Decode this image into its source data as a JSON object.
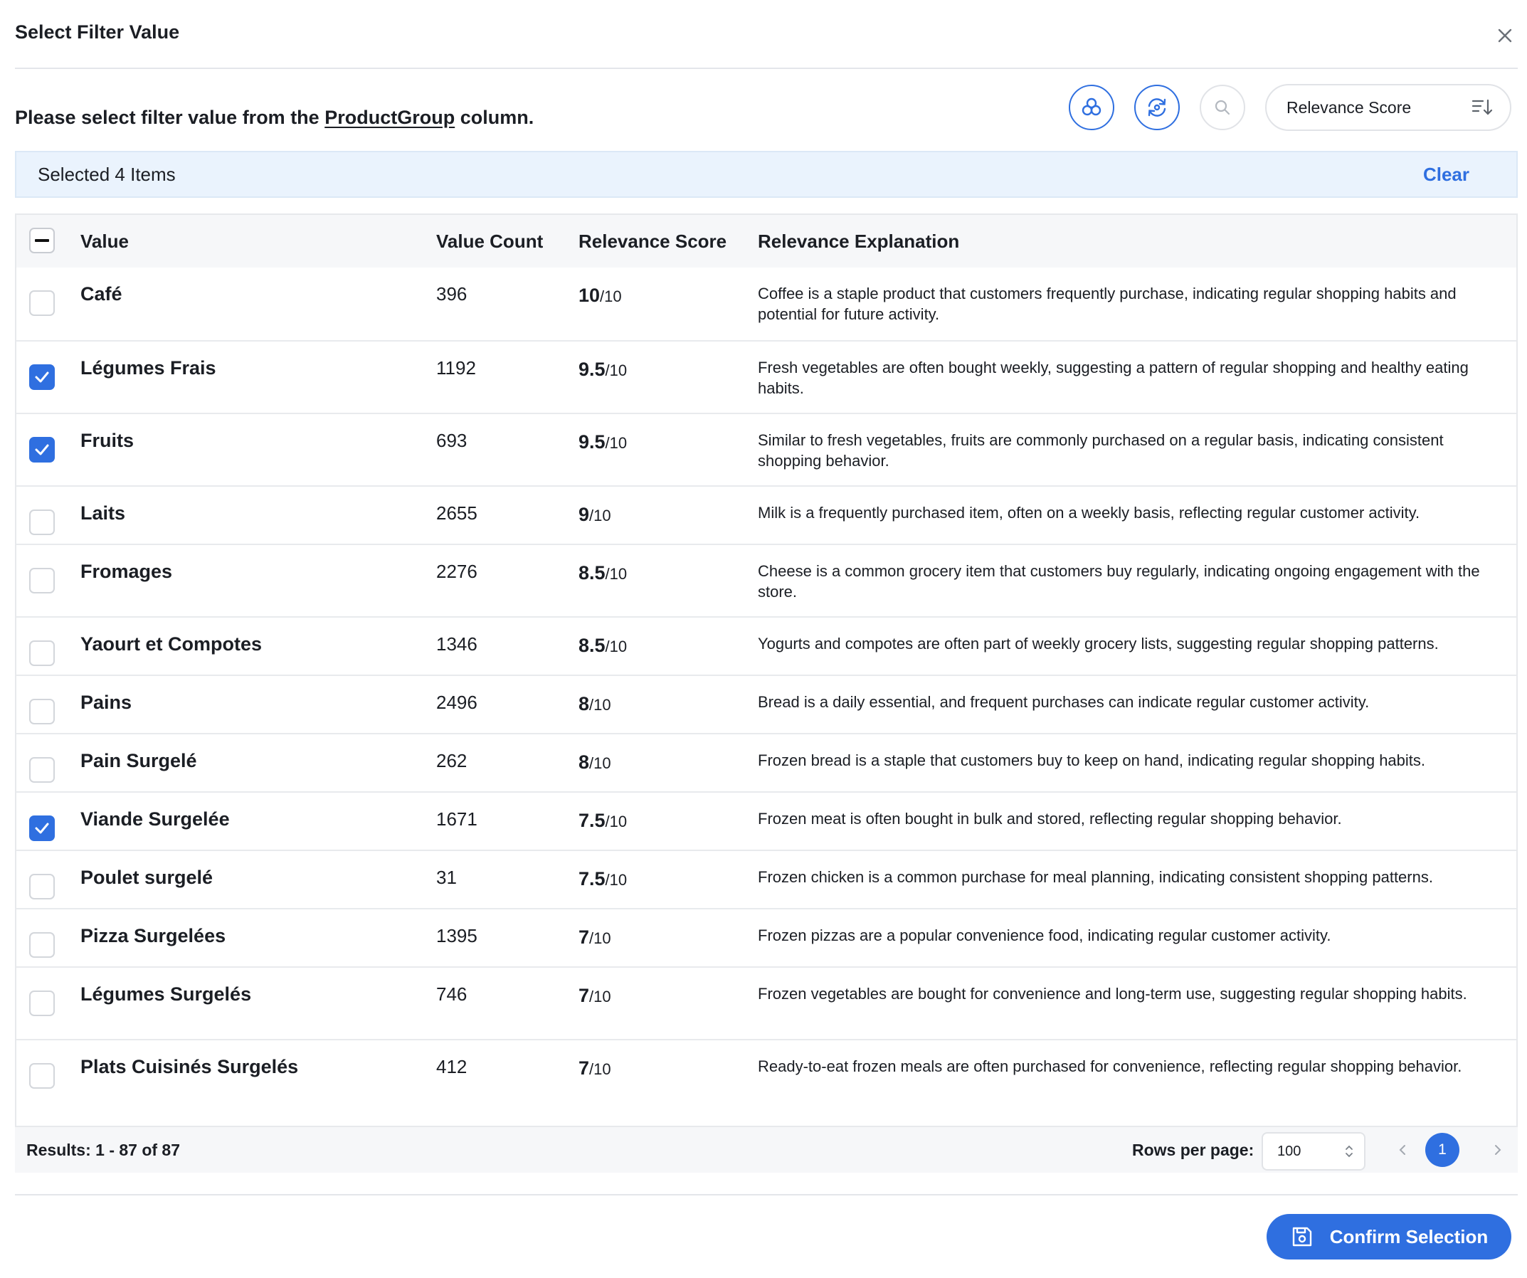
{
  "dialog": {
    "title": "Select Filter Value"
  },
  "prompt": {
    "before": "Please select filter value from the ",
    "column": "ProductGroup",
    "after": " column."
  },
  "toolbar": {
    "sort_label": "Relevance Score",
    "icons": [
      "clusters-icon",
      "refresh-icon",
      "search-icon",
      "sort-descending-icon"
    ]
  },
  "selection": {
    "text": "Selected 4 Items",
    "clear_label": "Clear"
  },
  "table": {
    "headers": {
      "value": "Value",
      "count": "Value Count",
      "score": "Relevance Score",
      "explanation": "Relevance Explanation"
    },
    "rows": [
      {
        "value": "Café",
        "count": "396",
        "score": "10",
        "den": "/10",
        "checked": false,
        "explanation": "Coffee is a staple product that customers frequently purchase, indicating regular shopping habits and potential for future activity."
      },
      {
        "value": "Légumes Frais",
        "count": "1192",
        "score": "9.5",
        "den": "/10",
        "checked": true,
        "explanation": "Fresh vegetables are often bought weekly, suggesting a pattern of regular shopping and healthy eating habits."
      },
      {
        "value": "Fruits",
        "count": "693",
        "score": "9.5",
        "den": "/10",
        "checked": true,
        "explanation": "Similar to fresh vegetables, fruits are commonly purchased on a regular basis, indicating consistent shopping behavior."
      },
      {
        "value": "Laits",
        "count": "2655",
        "score": "9",
        "den": "/10",
        "checked": false,
        "explanation": "Milk is a frequently purchased item, often on a weekly basis, reflecting regular customer activity."
      },
      {
        "value": "Fromages",
        "count": "2276",
        "score": "8.5",
        "den": "/10",
        "checked": false,
        "explanation": "Cheese is a common grocery item that customers buy regularly, indicating ongoing engagement with the store."
      },
      {
        "value": "Yaourt et Compotes",
        "count": "1346",
        "score": "8.5",
        "den": "/10",
        "checked": false,
        "explanation": "Yogurts and compotes are often part of weekly grocery lists, suggesting regular shopping patterns."
      },
      {
        "value": "Pains",
        "count": "2496",
        "score": "8",
        "den": "/10",
        "checked": false,
        "explanation": "Bread is a daily essential, and frequent purchases can indicate regular customer activity."
      },
      {
        "value": "Pain Surgelé",
        "count": "262",
        "score": "8",
        "den": "/10",
        "checked": false,
        "explanation": "Frozen bread is a staple that customers buy to keep on hand, indicating regular shopping habits."
      },
      {
        "value": "Viande Surgelée",
        "count": "1671",
        "score": "7.5",
        "den": "/10",
        "checked": true,
        "explanation": "Frozen meat is often bought in bulk and stored, reflecting regular shopping behavior."
      },
      {
        "value": "Poulet surgelé",
        "count": "31",
        "score": "7.5",
        "den": "/10",
        "checked": false,
        "explanation": "Frozen chicken is a common purchase for meal planning, indicating consistent shopping patterns."
      },
      {
        "value": "Pizza Surgelées",
        "count": "1395",
        "score": "7",
        "den": "/10",
        "checked": false,
        "explanation": "Frozen pizzas are a popular convenience food, indicating regular customer activity."
      },
      {
        "value": "Légumes Surgelés",
        "count": "746",
        "score": "7",
        "den": "/10",
        "checked": false,
        "explanation": "Frozen vegetables are bought for convenience and long-term use, suggesting regular shopping habits."
      },
      {
        "value": "Plats Cuisinés Surgelés",
        "count": "412",
        "score": "7",
        "den": "/10",
        "checked": false,
        "explanation": "Ready-to-eat frozen meals are often purchased for convenience, reflecting regular shopping behavior."
      }
    ]
  },
  "footer": {
    "results": "Results: 1 - 87 of 87",
    "rows_per_page_label": "Rows per page:",
    "rows_per_page_value": "100",
    "current_page": "1"
  },
  "confirm": {
    "label": "Confirm Selection"
  },
  "colors": {
    "accent": "#2f6fe0",
    "selected_bar_bg": "#eaf3fd"
  }
}
